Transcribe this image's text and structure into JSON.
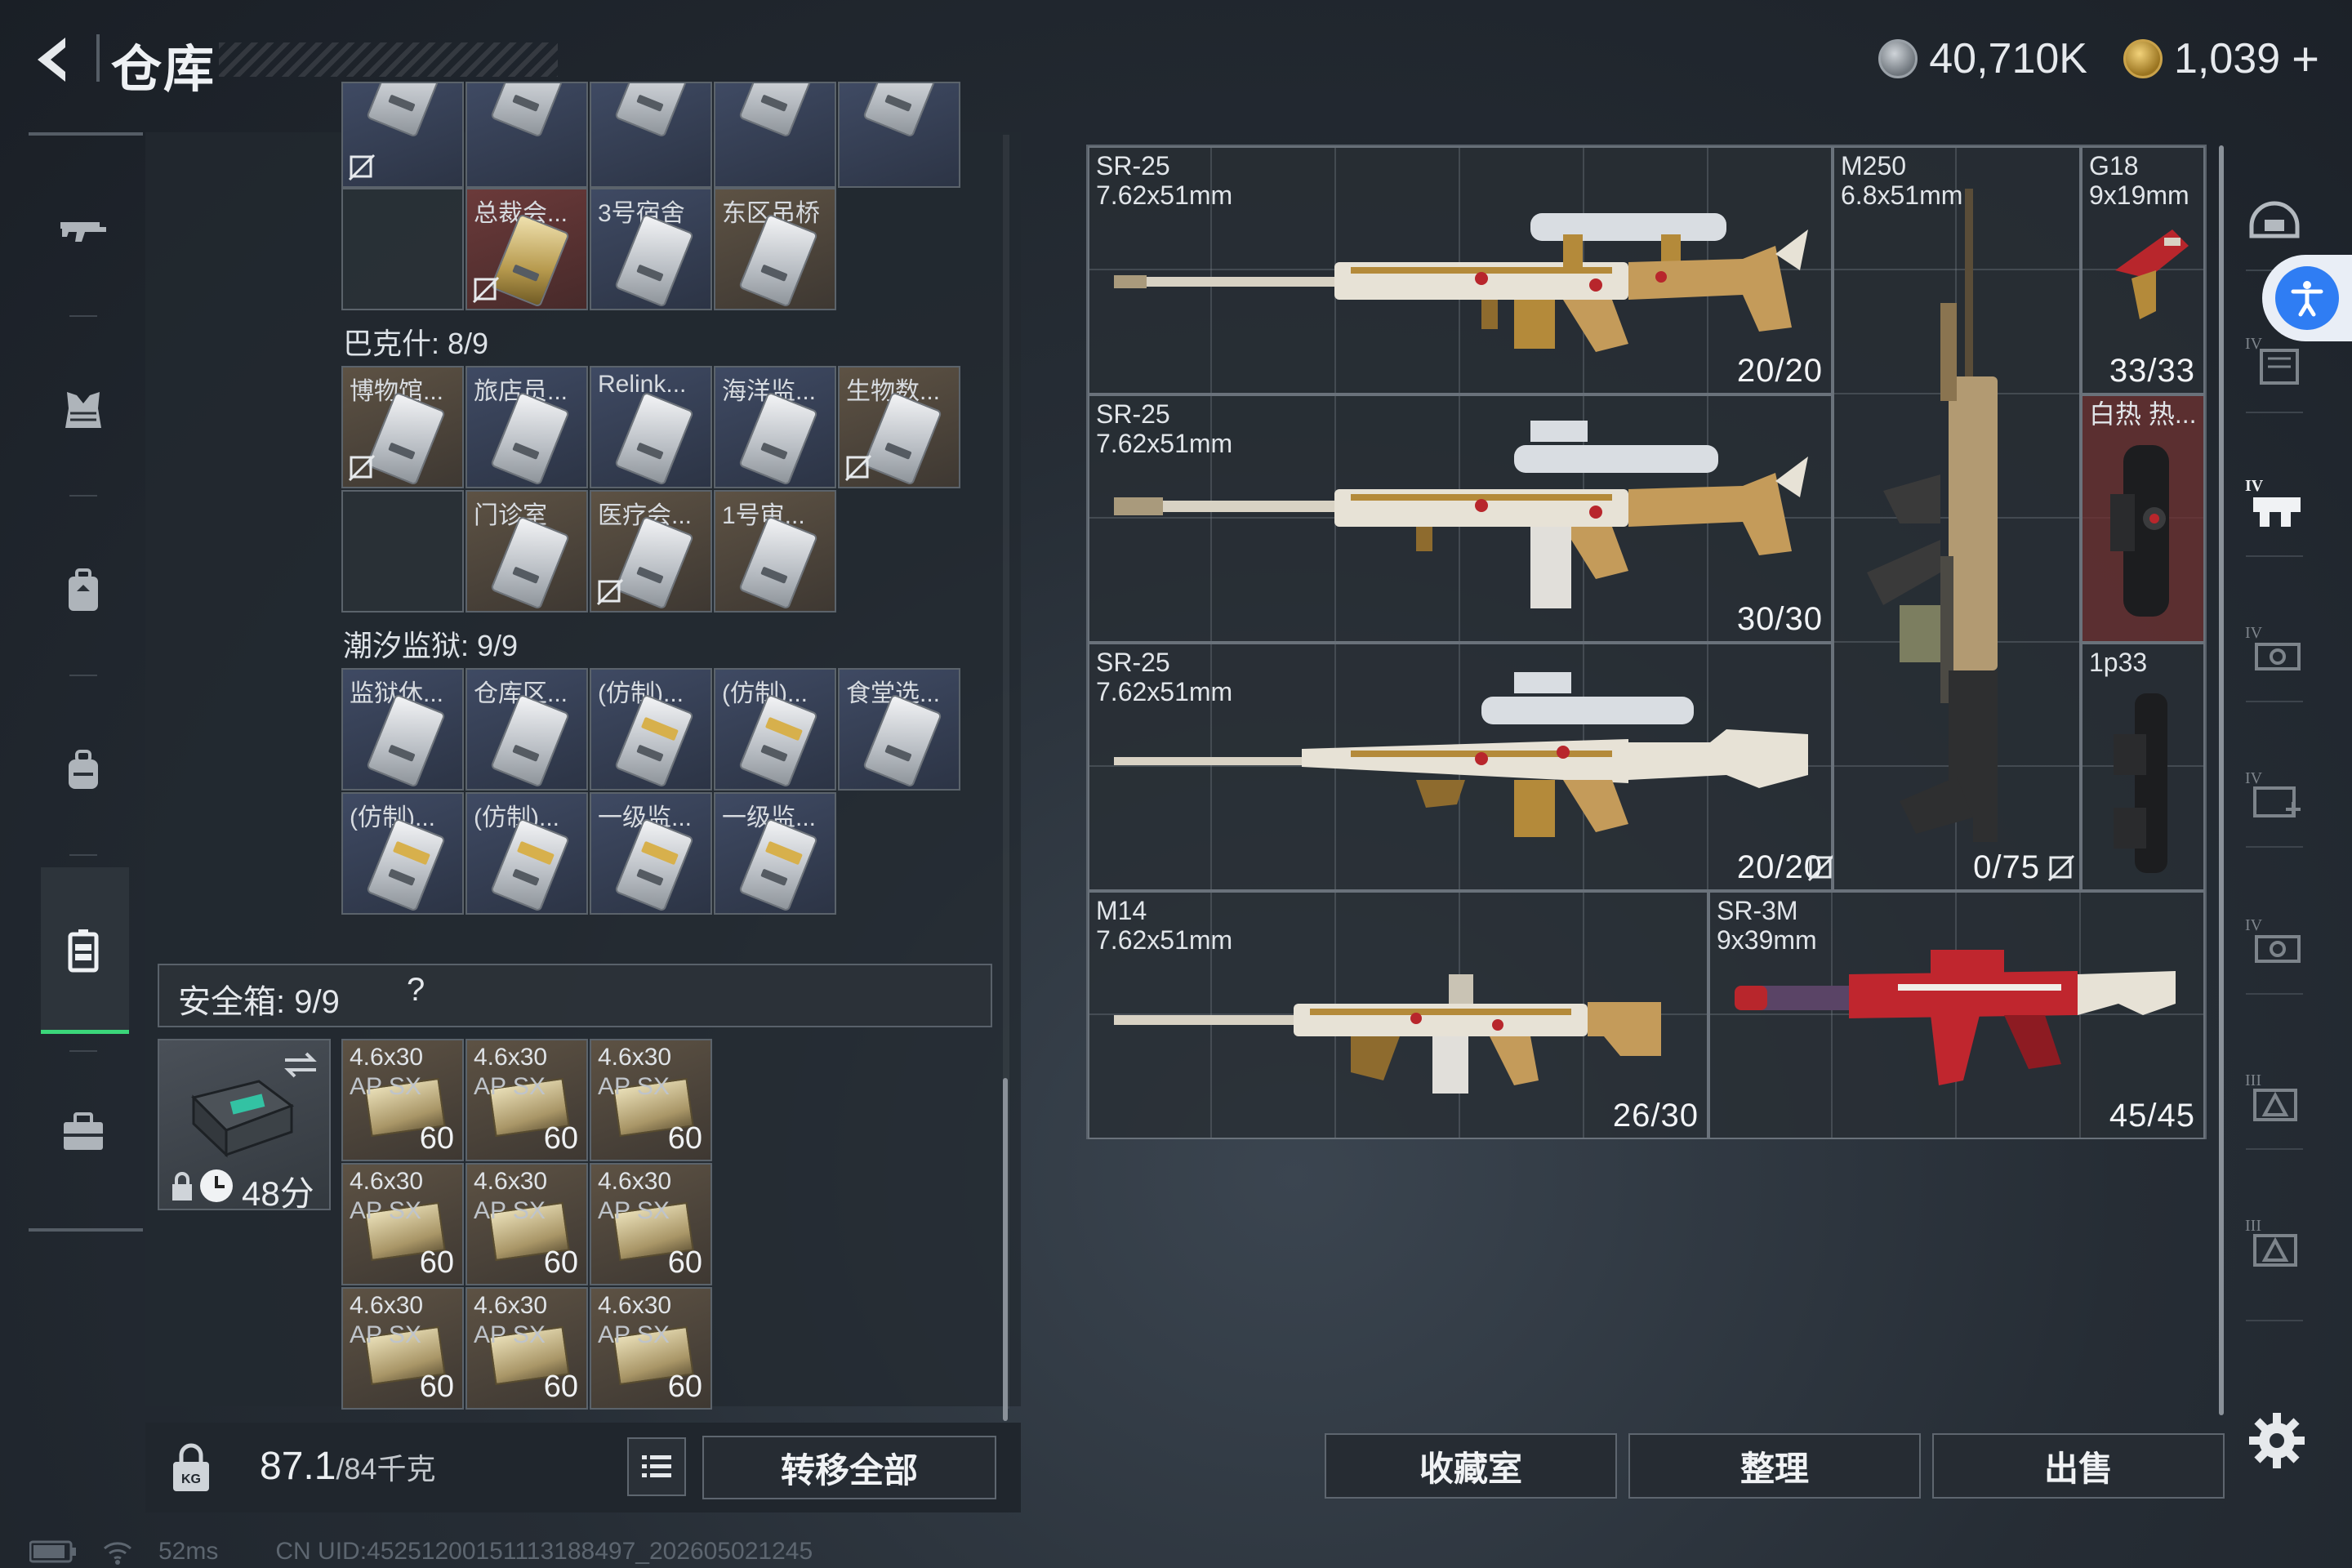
{
  "header": {
    "title": "仓库",
    "currency_silver": "40,710K",
    "currency_gold": "1,039",
    "currency_plus": "+"
  },
  "left_nav": {
    "items": [
      "rifle-icon",
      "armor-icon",
      "backpack-icon",
      "bag-icon",
      "card-case-icon",
      "toolbox-icon"
    ],
    "active": "card-case-icon"
  },
  "storage": {
    "top_partial_row": [
      {
        "label": "",
        "color": "blue"
      },
      {
        "label": "",
        "color": "blue"
      },
      {
        "label": "",
        "color": "blue"
      },
      {
        "label": "",
        "color": "blue"
      },
      {
        "label": "",
        "color": "blue"
      }
    ],
    "top_row2": [
      {
        "label": "总裁会...",
        "color": "red"
      },
      {
        "label": "3号宿舍",
        "color": "blue"
      },
      {
        "label": "东区吊桥",
        "color": "brown"
      }
    ],
    "section_bakesh": "巴克什: 8/9",
    "bakesh_row1": [
      {
        "label": "博物馆...",
        "color": "brown"
      },
      {
        "label": "旅店员...",
        "color": "blue"
      },
      {
        "label": "Relink...",
        "color": "blue"
      },
      {
        "label": "海洋监...",
        "color": "blue"
      },
      {
        "label": "生物数...",
        "color": "brown"
      }
    ],
    "bakesh_row2": [
      {
        "label": "门诊室",
        "color": "brown"
      },
      {
        "label": "医疗会...",
        "color": "brown"
      },
      {
        "label": "1号审...",
        "color": "brown"
      }
    ],
    "section_prison": "潮汐监狱: 9/9",
    "prison_row1": [
      {
        "label": "监狱休...",
        "color": "blue"
      },
      {
        "label": "仓库区...",
        "color": "blue"
      },
      {
        "label": "(仿制)...",
        "color": "blue"
      },
      {
        "label": "(仿制)...",
        "color": "blue"
      },
      {
        "label": "食堂选...",
        "color": "blue"
      }
    ],
    "prison_row2": [
      {
        "label": "(仿制)...",
        "color": "blue"
      },
      {
        "label": "(仿制)...",
        "color": "blue"
      },
      {
        "label": "一级监...",
        "color": "blue"
      },
      {
        "label": "一级监...",
        "color": "blue"
      }
    ]
  },
  "safe_box": {
    "title": "安全箱: 9/9",
    "help": "?",
    "timer": "48分",
    "ammo": [
      {
        "name": "4.6x30",
        "sub": "AP SX",
        "qty": "60"
      },
      {
        "name": "4.6x30",
        "sub": "AP SX",
        "qty": "60"
      },
      {
        "name": "4.6x30",
        "sub": "AP SX",
        "qty": "60"
      },
      {
        "name": "4.6x30",
        "sub": "AP SX",
        "qty": "60"
      },
      {
        "name": "4.6x30",
        "sub": "AP SX",
        "qty": "60"
      },
      {
        "name": "4.6x30",
        "sub": "AP SX",
        "qty": "60"
      },
      {
        "name": "4.6x30",
        "sub": "AP SX",
        "qty": "60"
      },
      {
        "name": "4.6x30",
        "sub": "AP SX",
        "qty": "60"
      },
      {
        "name": "4.6x30",
        "sub": "AP SX",
        "qty": "60"
      }
    ]
  },
  "bottom_left": {
    "weight_current": "87.1",
    "weight_max": "/84千克",
    "transfer_all": "转移全部"
  },
  "status": {
    "ping": "52ms",
    "uid": "CN UID:4525120015111318849​7_202605021245"
  },
  "weapons": [
    {
      "name": "SR-25",
      "caliber": "7.62x51mm",
      "ammo": "20/20"
    },
    {
      "name": "SR-25",
      "caliber": "7.62x51mm",
      "ammo": "30/30"
    },
    {
      "name": "SR-25",
      "caliber": "7.62x51mm",
      "ammo": "20/20"
    },
    {
      "name": "M250",
      "caliber": "6.8x51mm",
      "ammo": "0/75"
    },
    {
      "name": "G18",
      "caliber": "9x19mm",
      "ammo": "33/33"
    },
    {
      "name": "白热 热...",
      "caliber": "",
      "ammo": ""
    },
    {
      "name": "1p33",
      "caliber": "",
      "ammo": ""
    },
    {
      "name": "M14",
      "caliber": "7.62x51mm",
      "ammo": "26/30"
    },
    {
      "name": "SR-3M",
      "caliber": "9x39mm",
      "ammo": "45/45"
    }
  ],
  "right_tabs": [
    "helmet-icon",
    "armor-tier4-icon",
    "rig-tier4-icon",
    "scope-tier4-icon",
    "medkit-tier4-icon",
    "scope-tier4-icon",
    "warning-tier3-icon",
    "warning-tier3-icon"
  ],
  "bottom_right": {
    "collection": "收藏室",
    "organize": "整理",
    "sell": "出售"
  },
  "colors": {
    "accent_green": "#3bd67a",
    "accessibility_blue": "#2f7df3"
  }
}
